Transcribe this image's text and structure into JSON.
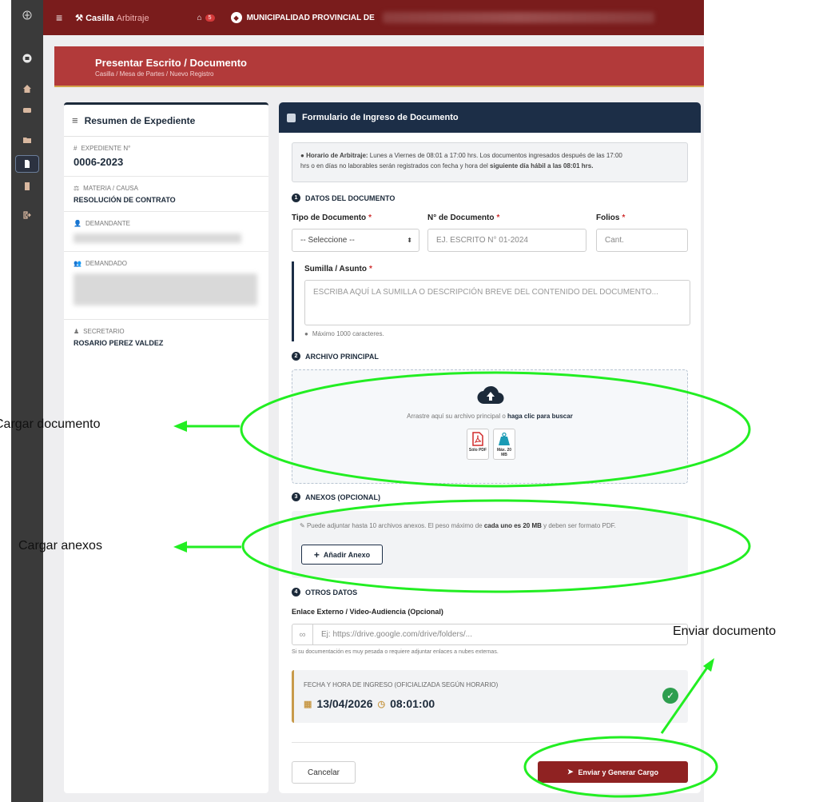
{
  "topbar": {
    "brand_bold": "Casilla",
    "brand_light": "Arbitraje",
    "inbox_count": "5",
    "institution": "MUNICIPALIDAD PROVINCIAL DE"
  },
  "page": {
    "title": "Presentar Escrito / Documento",
    "breadcrumb": "Casilla  /  Mesa de Partes  /  Nuevo Registro"
  },
  "summary": {
    "title": "Resumen de Expediente",
    "expediente_label": "EXPEDIENTE N°",
    "expediente_value": "0006-2023",
    "materia_label": "MATERIA / CAUSA",
    "materia_value": "RESOLUCIÓN DE CONTRATO",
    "demandante_label": "DEMANDANTE",
    "demandado_label": "DEMANDADO",
    "secretario_label": "SECRETARIO",
    "secretario_value": "ROSARIO PEREZ VALDEZ"
  },
  "form": {
    "title": "Formulario de Ingreso de Documento",
    "info_bold": "Horario de Arbitraje:",
    "info_text1": " Lunes a Viernes de 08:01 a 17:00 hrs. Los documentos ingresados después de las 17:00",
    "info_text2": "hrs o en días no laborables serán registrados con fecha y hora del ",
    "info_bold2": "siguiente día hábil a las 08:01 hrs.",
    "s1": "DATOS DEL DOCUMENTO",
    "tipo_label": "Tipo de Documento",
    "tipo_value": "-- Seleccione --",
    "numero_label": "N° de Documento",
    "numero_placeholder": "EJ. ESCRITO N° 01-2024",
    "folios_label": "Folios",
    "folios_placeholder": "Cant.",
    "sumilla_label": "Sumilla / Asunto",
    "sumilla_placeholder": "ESCRIBA AQUÍ LA SUMILLA O DESCRIPCIÓN BREVE DEL CONTENIDO DEL DOCUMENTO...",
    "sumilla_hint": "Máximo 1000 caracteres.",
    "s2": "ARCHIVO PRINCIPAL",
    "drop_text": "Arrastre aquí su archivo principal o ",
    "drop_link": "haga clic para buscar",
    "tile_pdf": "Sólo PDF",
    "tile_size": "Máx. 20 MB",
    "s3": "ANEXOS (OPCIONAL)",
    "anexos_text1": "Puede adjuntar hasta 10 archivos anexos. El peso máximo de ",
    "anexos_bold": "cada uno es 20 MB",
    "anexos_text2": " y deben ser formato PDF.",
    "add_anexo": "Añadir Anexo",
    "s4": "OTROS DATOS",
    "link_label": "Enlace Externo / Video-Audiencia (Opcional)",
    "link_placeholder": "Ej: https://drive.google.com/drive/folders/...",
    "link_hint": "Si su documentación es muy pesada o requiere adjuntar enlaces a nubes externas.",
    "fecha_label": "FECHA Y HORA DE INGRESO (OFICIALIZADA SEGÚN HORARIO)",
    "fecha_value": "13/04/2026",
    "hora_value": "08:01:00",
    "cancel": "Cancelar",
    "submit": "Enviar y Generar Cargo"
  },
  "annotations": {
    "cargar_documento": "Cargar documento",
    "cargar_anexos": "Cargar anexos",
    "enviar_documento": "Enviar documento"
  },
  "colors": {
    "topbar": "#7a1c1c",
    "accent_green": "#22ee22",
    "form_header": "#1c2e47",
    "submit": "#8f2222"
  }
}
